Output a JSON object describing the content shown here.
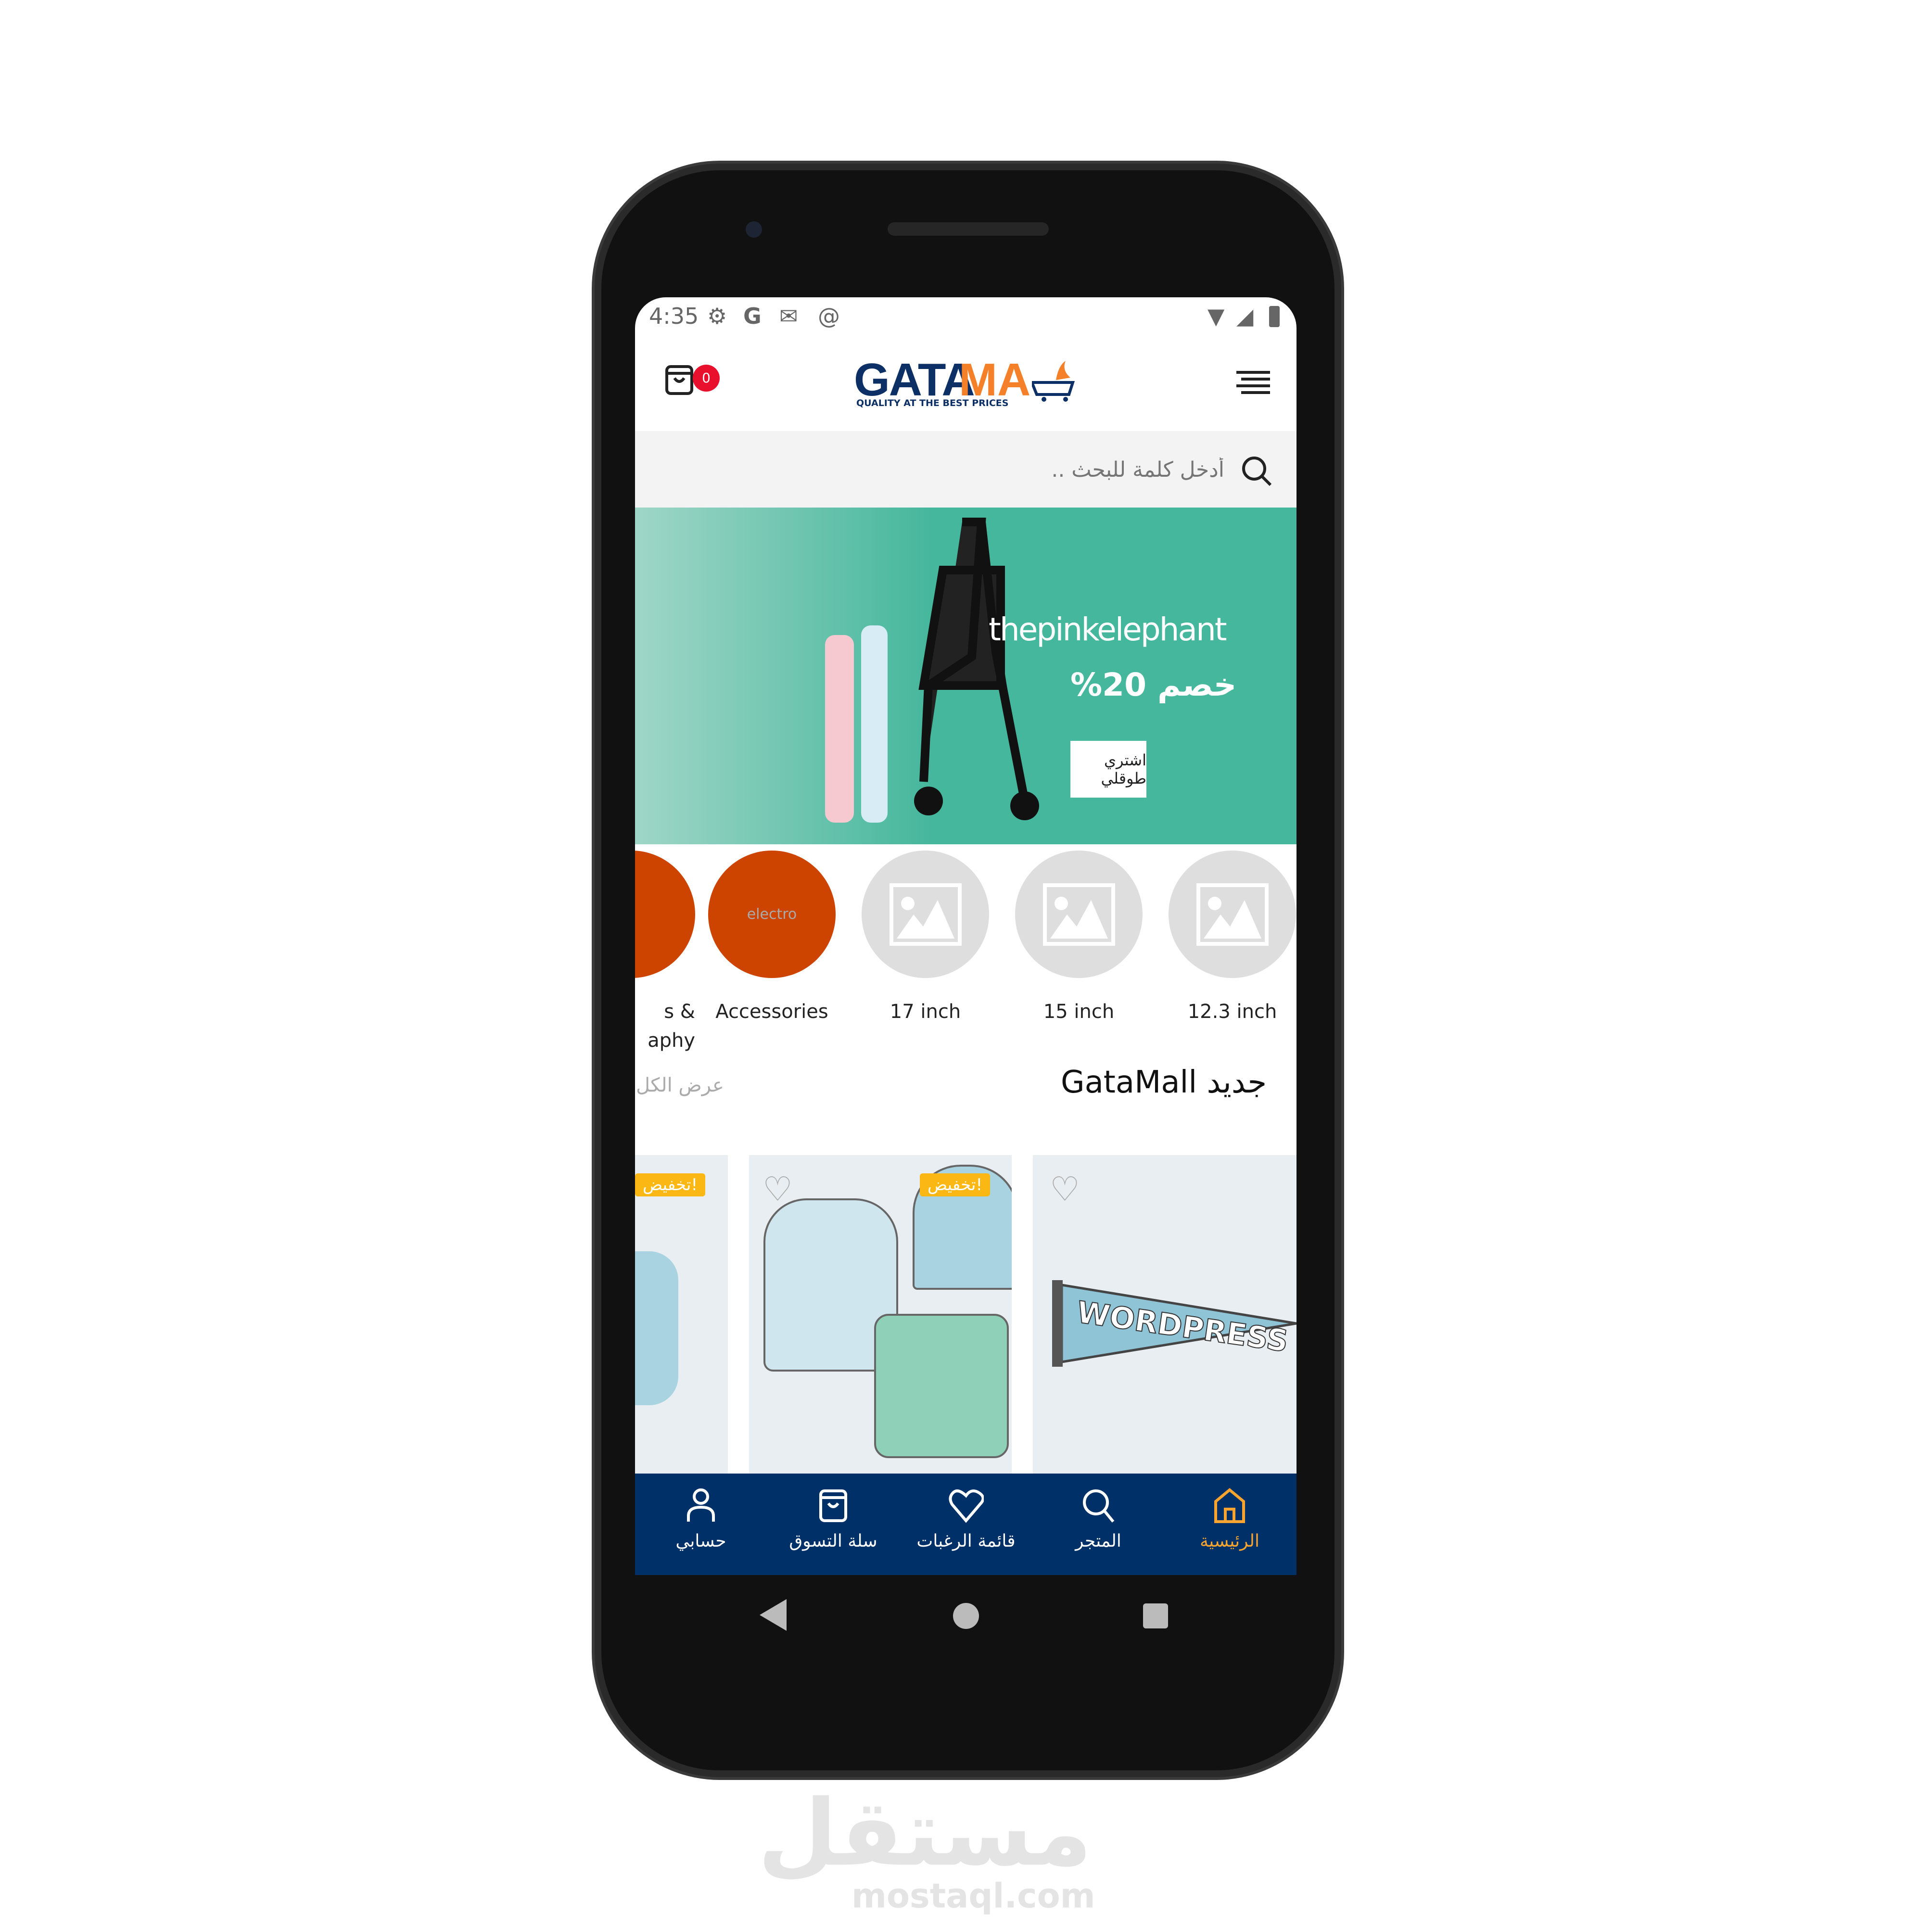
{
  "status_bar": {
    "time": "4:35",
    "icons": [
      "gear-icon",
      "google-icon",
      "gmail-icon",
      "at-icon"
    ],
    "right_icons": [
      "wifi-icon",
      "signal-icon",
      "battery-icon"
    ]
  },
  "header": {
    "cart_count": "0",
    "logo_text": "GATAMALL",
    "logo_tagline": "QUALITY AT THE BEST PRICES",
    "brand_blue": "#0c2f66",
    "brand_orange": "#f5802a",
    "badge_color": "#e8102c"
  },
  "search": {
    "placeholder": "أدخل كلمة للبحث .."
  },
  "banner": {
    "brand": "thepinkelephant",
    "discount": "خصم 20%",
    "cta": "اشتري طوقلي",
    "color": "#45b79c"
  },
  "categories": [
    {
      "label": "s & aphy",
      "image": "orange"
    },
    {
      "label": "Accessories",
      "image_text": "electro"
    },
    {
      "label": "17 inch",
      "image": "placeholder-image-icon"
    },
    {
      "label": "15 inch",
      "image": "placeholder-image-icon"
    },
    {
      "label": "12.3 inch",
      "image": "placeholder-image-icon"
    }
  ],
  "section": {
    "title": "جديد GataMall",
    "view_all": "عرض الكل"
  },
  "products": [
    {
      "badge": "تخفيض!"
    },
    {
      "badge": "تخفيض!"
    },
    {
      "image_text": "WORDPRESS"
    }
  ],
  "bottom_nav": {
    "items": [
      {
        "label": "حسابي",
        "icon": "user-icon"
      },
      {
        "label": "سلة التسوق",
        "icon": "bag-icon"
      },
      {
        "label": "قائمة الرغبات",
        "icon": "heart-icon"
      },
      {
        "label": "المتجر",
        "icon": "search-icon"
      },
      {
        "label": "الرئيسية",
        "icon": "home-icon",
        "active": true
      }
    ],
    "bg": "#003068",
    "active_color": "#f7a530"
  },
  "watermark": {
    "arabic": "مستقل",
    "latin": "mostaql.com"
  }
}
